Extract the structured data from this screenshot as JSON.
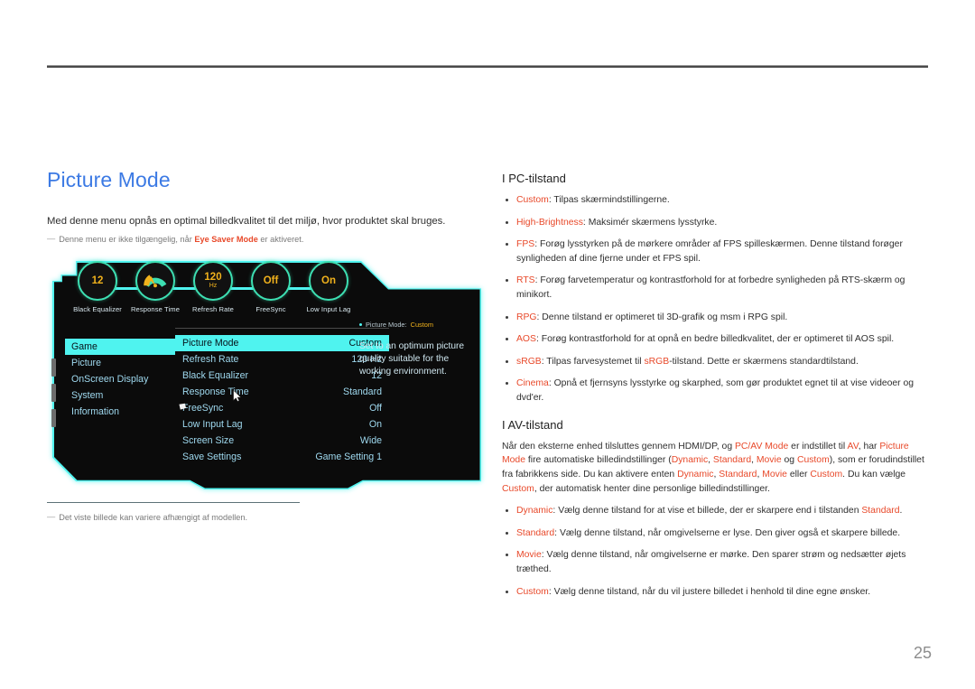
{
  "page": {
    "number": "25"
  },
  "left": {
    "section_title": "Picture Mode",
    "intro": "Med denne menu opnås en optimal billedkvalitet til det miljø, hvor produktet skal bruges.",
    "note_prefix": "Denne menu er ikke tilgængelig, når ",
    "note_highlight": "Eye Saver Mode",
    "note_suffix": " er aktiveret.",
    "bottom_note": "Det viste billede kan variere afhængigt af modellen."
  },
  "osd": {
    "dials": [
      {
        "label": "Black Equalizer",
        "value": "12",
        "unit": "",
        "icon": "number-dial"
      },
      {
        "label": "Response Time",
        "value": "",
        "unit": "",
        "icon": "gauge-icon"
      },
      {
        "label": "Refresh Rate",
        "value": "120",
        "unit": "Hz",
        "icon": "number-dial"
      },
      {
        "label": "FreeSync",
        "value": "Off",
        "unit": "",
        "icon": "number-dial"
      },
      {
        "label": "Low Input Lag",
        "value": "On",
        "unit": "",
        "icon": "number-dial"
      }
    ],
    "categories": [
      {
        "label": "Game",
        "selected": true
      },
      {
        "label": "Picture",
        "selected": false
      },
      {
        "label": "OnScreen Display",
        "selected": false
      },
      {
        "label": "System",
        "selected": false
      },
      {
        "label": "Information",
        "selected": false
      }
    ],
    "settings": [
      {
        "label": "Picture Mode",
        "value": "Custom",
        "selected": true
      },
      {
        "label": "Refresh Rate",
        "value": "120 Hz",
        "selected": false
      },
      {
        "label": "Black Equalizer",
        "value": "12",
        "selected": false
      },
      {
        "label": "Response Time",
        "value": "Standard",
        "selected": false
      },
      {
        "label": "FreeSync",
        "value": "Off",
        "selected": false
      },
      {
        "label": "Low Input Lag",
        "value": "On",
        "selected": false
      },
      {
        "label": "Screen Size",
        "value": "Wide",
        "selected": false
      },
      {
        "label": "Save Settings",
        "value": "Game Setting 1",
        "selected": false
      }
    ],
    "breadcrumb_label": "Picture Mode:",
    "breadcrumb_value": "Custom",
    "description": "Set to an optimum picture quality suitable for the working environment."
  },
  "right": {
    "pc_heading": "I PC-tilstand",
    "pc_items": [
      {
        "term": "Custom",
        "text": ": Tilpas skærmindstillingerne."
      },
      {
        "term": "High-Brightness",
        "text": ": Maksimér skærmens lysstyrke."
      },
      {
        "term": "FPS",
        "text": ": Forøg lysstyrken på de mørkere områder af FPS spilleskærmen. Denne tilstand forøger synligheden af dine fjerne under et FPS spil."
      },
      {
        "term": "RTS",
        "text": ": Forøg farvetemperatur og kontrastforhold for at forbedre synligheden på RTS-skærm og minikort."
      },
      {
        "term": "RPG",
        "text": ": Denne tilstand er optimeret til 3D-grafik og msm i RPG spil."
      },
      {
        "term": "AOS",
        "text": ": Forøg kontrastforhold for at opnå en bedre billedkvalitet, der er optimeret til AOS spil."
      },
      {
        "term": "sRGB",
        "text": ": Tilpas farvesystemet til sRGB-tilstand. Dette er skærmens standardtilstand."
      },
      {
        "term": "Cinema",
        "text": ": Opnå et fjernsyns lysstyrke og skarphed, som gør produktet egnet til at vise videoer og dvd'er."
      }
    ],
    "av_heading": "I AV-tilstand",
    "av_paragraph": "Når den eksterne enhed tilsluttes gennem HDMI/DP, og PC/AV Mode er indstillet til AV, har Picture Mode fire automatiske billedindstillinger (Dynamic, Standard, Movie og Custom), som er forudindstillet fra fabrikkens side. Du kan aktivere enten Dynamic, Standard, Movie eller Custom. Du kan vælge Custom, der automatisk henter dine personlige billedindstillinger.",
    "av_items": [
      {
        "term": "Dynamic",
        "text": ": Vælg denne tilstand for at vise et billede, der er skarpere end i tilstanden Standard."
      },
      {
        "term": "Standard",
        "text": ": Vælg denne tilstand, når omgivelserne er lyse. Den giver også et skarpere billede."
      },
      {
        "term": "Movie",
        "text": ": Vælg denne tilstand, når omgivelserne er mørke. Den sparer strøm og nedsætter øjets træthed."
      },
      {
        "term": "Custom",
        "text": ": Vælg denne tilstand, når du vil justere billedet i henhold til dine egne ønsker."
      }
    ]
  },
  "colors": {
    "title_blue": "#3c7ae4",
    "highlight_orange": "#e8492a",
    "osd_cyan": "#4ff3ef",
    "osd_amber": "#f1b21c",
    "osd_green": "#3ddfb2"
  }
}
